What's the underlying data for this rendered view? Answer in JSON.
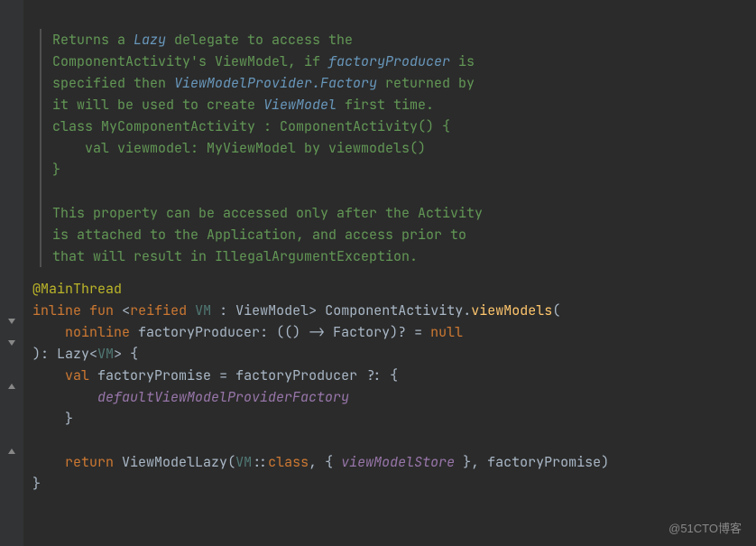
{
  "doc": {
    "l1_pre": "Returns a ",
    "l1_link": "Lazy",
    "l1_post": " delegate to access the",
    "l2_pre": "ComponentActivity's ViewModel, if ",
    "l2_link": "factoryProducer",
    "l2_post": " is",
    "l3_pre": "specified then ",
    "l3_link": "ViewModelProvider.Factory",
    "l3_post": " returned by",
    "l4_pre": "it will be used to create ",
    "l4_link": "ViewModel",
    "l4_post": " first time.",
    "code1": "class MyComponentActivity : ComponentActivity() {",
    "code2": "    val viewmodel: MyViewModel by viewmodels()",
    "code3": "}",
    "l5": "This property can be accessed only after the Activity",
    "l6": "is attached to the Application, and access prior to",
    "l7": "that will result in IllegalArgumentException."
  },
  "code": {
    "annotation": "@MainThread",
    "kw_inline": "inline",
    "kw_fun": "fun",
    "kw_reified": "reified",
    "tp_vm": "VM",
    "type_viewmodel": "ViewModel",
    "type_ca": "ComponentActivity",
    "func_viewmodels": "viewModels",
    "kw_noinline": "noinline",
    "param_fp": "factoryProducer",
    "type_factory": "Factory",
    "lit_null": "null",
    "type_lazy": "Lazy",
    "kw_val": "val",
    "var_fp": "factoryPromise",
    "expr_default": "defaultViewModelProviderFactory",
    "kw_return": "return",
    "type_vml": "ViewModelLazy",
    "kw_class": "class",
    "expr_vms": "viewModelStore"
  },
  "watermark": "@51CTO博客"
}
